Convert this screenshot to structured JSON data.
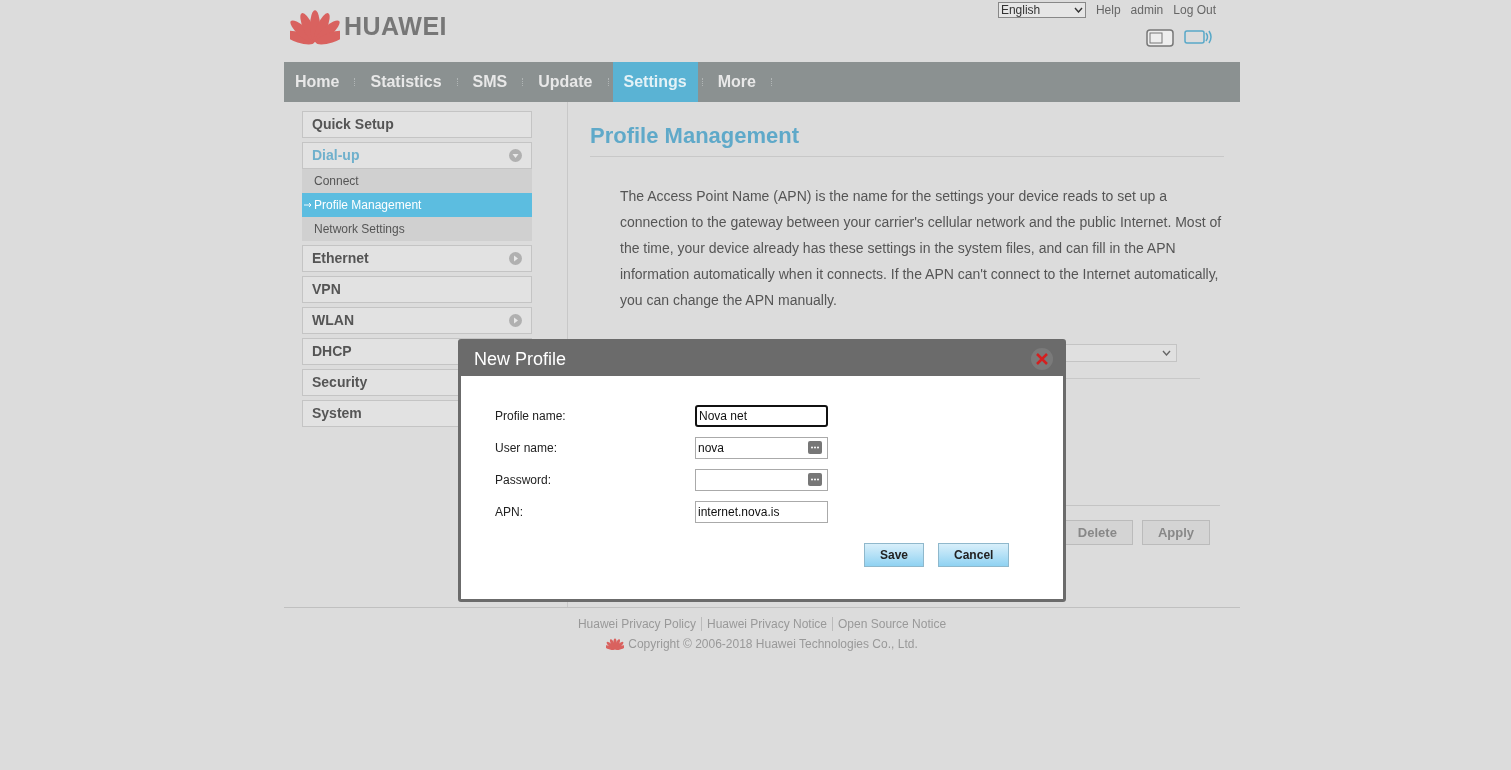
{
  "header": {
    "brand": "HUAWEI",
    "language": "English",
    "links": [
      "Help",
      "admin",
      "Log Out"
    ]
  },
  "nav": [
    {
      "label": "Home",
      "selected": false
    },
    {
      "label": "Statistics",
      "selected": false
    },
    {
      "label": "SMS",
      "selected": false
    },
    {
      "label": "Update",
      "selected": false
    },
    {
      "label": "Settings",
      "selected": true
    },
    {
      "label": "More",
      "selected": false
    }
  ],
  "sidebar": {
    "items": [
      {
        "label": "Quick Setup",
        "kind": "link",
        "selected": false
      },
      {
        "label": "Dial-up",
        "kind": "menu",
        "selected": true,
        "expanded": true,
        "children": [
          {
            "label": "Connect",
            "selected": false
          },
          {
            "label": "Profile Management",
            "selected": true
          },
          {
            "label": "Network Settings",
            "selected": false
          }
        ]
      },
      {
        "label": "Ethernet",
        "kind": "menu",
        "selected": false,
        "expanded": false
      },
      {
        "label": "VPN",
        "kind": "link",
        "selected": false
      },
      {
        "label": "WLAN",
        "kind": "menu",
        "selected": false,
        "expanded": false
      },
      {
        "label": "DHCP",
        "kind": "link",
        "selected": false
      },
      {
        "label": "Security",
        "kind": "link",
        "selected": false
      },
      {
        "label": "System",
        "kind": "link",
        "selected": false
      }
    ]
  },
  "main": {
    "title": "Profile Management",
    "description": "The Access Point Name (APN) is the name for the settings your device reads to set up a connection to the gateway between your carrier's cellular network and the public Internet. Most of the time, your device already has these settings in the system files, and can fill in the APN information automatically when it connects. If the APN can't connect to the Internet automatically, you can change the APN manually.",
    "buttons": [
      "Delete",
      "Apply"
    ]
  },
  "dialog": {
    "title": "New Profile",
    "fields": [
      {
        "label": "Profile name:",
        "value": "Nova net",
        "focused": true,
        "picker": false
      },
      {
        "label": "User name:",
        "value": "nova",
        "focused": false,
        "picker": true
      },
      {
        "label": "Password:",
        "focused": false,
        "picker": true
      },
      {
        "label": "APN:",
        "value": "internet.nova.is",
        "focused": false,
        "picker": false
      }
    ],
    "buttons": [
      "Save",
      "Cancel"
    ]
  },
  "footer": {
    "links": [
      "Huawei Privacy Policy",
      "Huawei Privacy Notice",
      "Open Source Notice"
    ],
    "copyright": "Copyright © 2006-2018 Huawei Technologies Co., Ltd."
  }
}
